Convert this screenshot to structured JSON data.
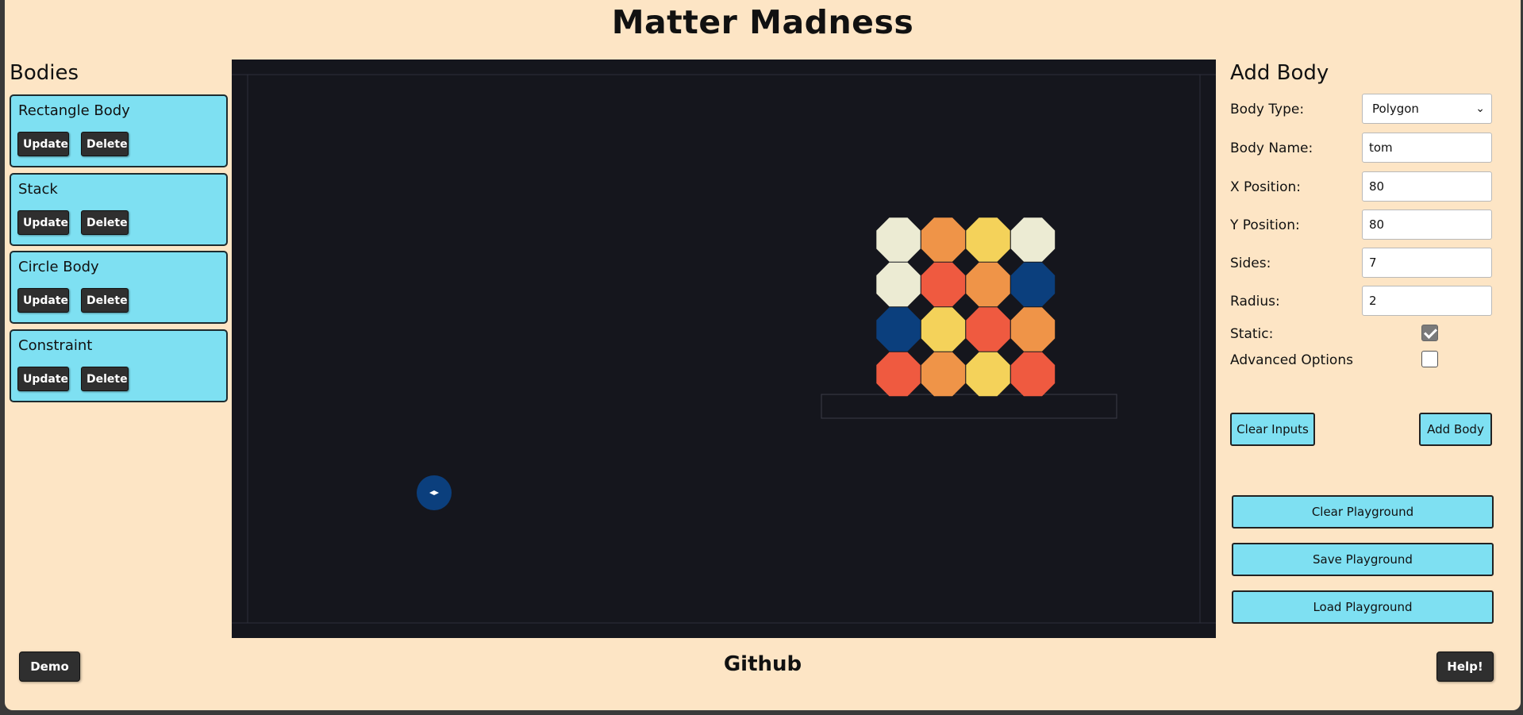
{
  "app": {
    "title": "Matter Madness",
    "footer_link": "Github"
  },
  "bodies_panel": {
    "heading": "Bodies",
    "items": [
      {
        "name": "Rectangle Body",
        "update": "Update",
        "delete": "Delete"
      },
      {
        "name": "Stack",
        "update": "Update",
        "delete": "Delete"
      },
      {
        "name": "Circle Body",
        "update": "Update",
        "delete": "Delete"
      },
      {
        "name": "Constraint",
        "update": "Update",
        "delete": "Delete"
      }
    ]
  },
  "form": {
    "heading": "Add Body",
    "body_type_label": "Body Type:",
    "body_type_value": "Polygon",
    "body_name_label": "Body Name:",
    "body_name_value": "tom",
    "x_label": "X Position:",
    "x_value": "80",
    "y_label": "Y Position:",
    "y_value": "80",
    "sides_label": "Sides:",
    "sides_value": "7",
    "radius_label": "Radius:",
    "radius_value": "2",
    "static_label": "Static:",
    "static_checked": true,
    "advanced_label": "Advanced Options",
    "advanced_checked": false,
    "clear_inputs": "Clear Inputs",
    "add_body": "Add Body"
  },
  "playground": {
    "clear": "Clear Playground",
    "save": "Save Playground",
    "load": "Load Playground"
  },
  "footer": {
    "demo": "Demo",
    "help": "Help!"
  },
  "colors": {
    "background": "#fde5c5",
    "accent": "#7ee0f2",
    "canvas": "#15161d",
    "cream": "#ecebd3",
    "orange": "#ef9448",
    "yellow": "#f4d25a",
    "red": "#ef5a40",
    "navy": "#0b3f7d"
  },
  "canvas_scene": {
    "octagon_grid": [
      [
        "cream",
        "orange",
        "yellow",
        "cream"
      ],
      [
        "cream",
        "red",
        "orange",
        "navy"
      ],
      [
        "navy",
        "yellow",
        "red",
        "orange"
      ],
      [
        "red",
        "orange",
        "yellow",
        "red"
      ]
    ]
  }
}
